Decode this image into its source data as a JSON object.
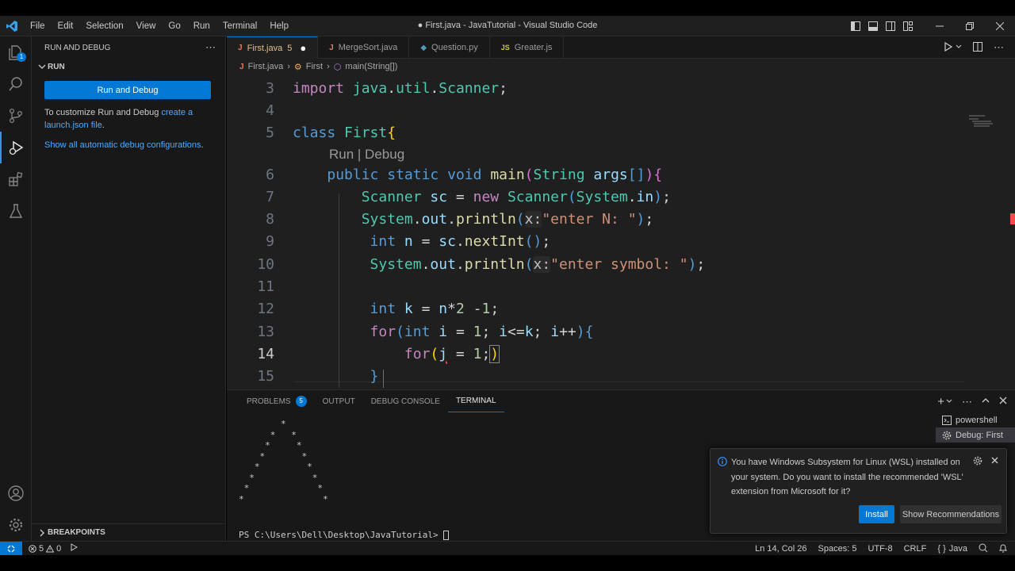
{
  "window": {
    "title": "● First.java - JavaTutorial - Visual Studio Code",
    "menu": [
      "File",
      "Edit",
      "Selection",
      "View",
      "Go",
      "Run",
      "Terminal",
      "Help"
    ]
  },
  "activity": {
    "explorer_badge": "1"
  },
  "sidebar": {
    "header": "RUN AND DEBUG",
    "section": "RUN",
    "run_button": "Run and Debug",
    "customize_text": "To customize Run and Debug ",
    "customize_link": "create a launch.json file",
    "customize_end": ".",
    "show_all_link": "Show all automatic debug configurations",
    "show_all_end": ".",
    "breakpoints": "BREAKPOINTS"
  },
  "tabs": [
    {
      "label": "First.java",
      "suffix": "5",
      "icon": "J"
    },
    {
      "label": "MergeSort.java",
      "icon": "J"
    },
    {
      "label": "Question.py",
      "icon": "python-icon"
    },
    {
      "label": "Greater.js",
      "icon": "JS"
    }
  ],
  "breadcrumb": {
    "file": "First.java",
    "class": "First",
    "method": "main(String[])"
  },
  "code": {
    "line_numbers": [
      "3",
      "4",
      "5",
      "6",
      "7",
      "8",
      "9",
      "10",
      "11",
      "12",
      "13",
      "14",
      "15"
    ],
    "codelens": "Run | Debug"
  },
  "panel": {
    "tabs": [
      {
        "label": "PROBLEMS",
        "badge": "5"
      },
      {
        "label": "OUTPUT"
      },
      {
        "label": "DEBUG CONSOLE"
      },
      {
        "label": "TERMINAL"
      }
    ],
    "terminal_output": "        *\n      *   *\n     *     *\n    *       *\n   *         *\n  *           *\n *             *\n*               *",
    "prompt": "PS C:\\Users\\Dell\\Desktop\\JavaTutorial> ",
    "terminals": [
      "powershell",
      "Debug: First"
    ]
  },
  "notification": {
    "message": "You have Windows Subsystem for Linux (WSL) installed on your system. Do you want to install the recommended 'WSL' extension from Microsoft for it?",
    "install": "Install",
    "show_recommendations": "Show Recommendations"
  },
  "status": {
    "errors": "5",
    "warnings": "0",
    "position": "Ln 14, Col 26",
    "spaces": "Spaces: 5",
    "encoding": "UTF-8",
    "eol": "CRLF",
    "language": "Java"
  }
}
